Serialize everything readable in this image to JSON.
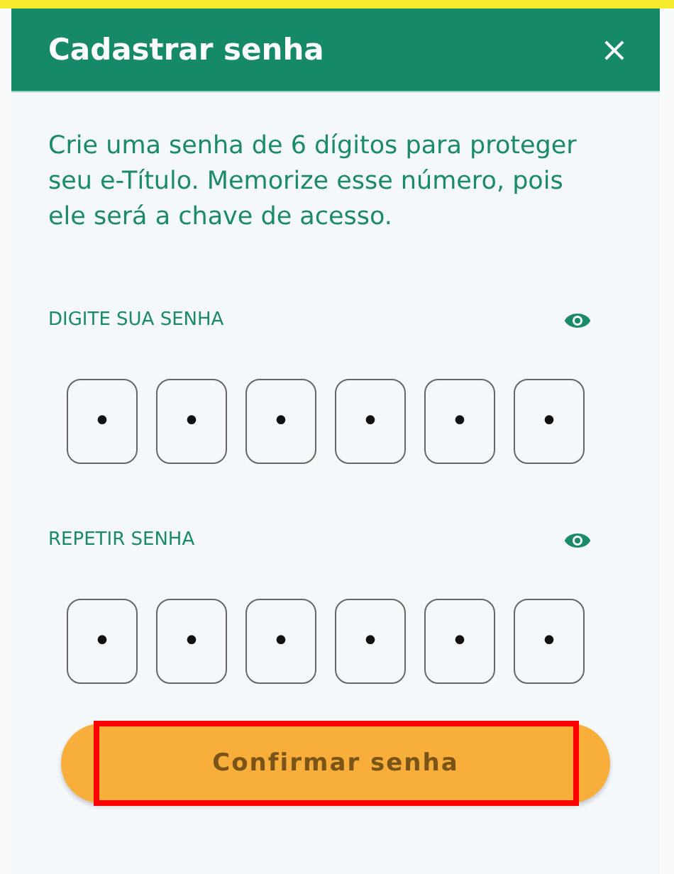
{
  "header": {
    "title": "Cadastrar senha",
    "close": "×"
  },
  "intro": "Crie uma senha de 6 dígitos para proteger seu e-Título. Memorize esse número, pois ele será a chave de acesso.",
  "fields": [
    {
      "label": "DIGITE SUA SENHA",
      "visible": false,
      "digits": [
        "•",
        "•",
        "•",
        "•",
        "•",
        "•"
      ]
    },
    {
      "label": "REPETIR SENHA",
      "visible": false,
      "digits": [
        "•",
        "•",
        "•",
        "•",
        "•",
        "•"
      ]
    }
  ],
  "button": {
    "label": "Confirmar senha",
    "highlighted": true
  }
}
